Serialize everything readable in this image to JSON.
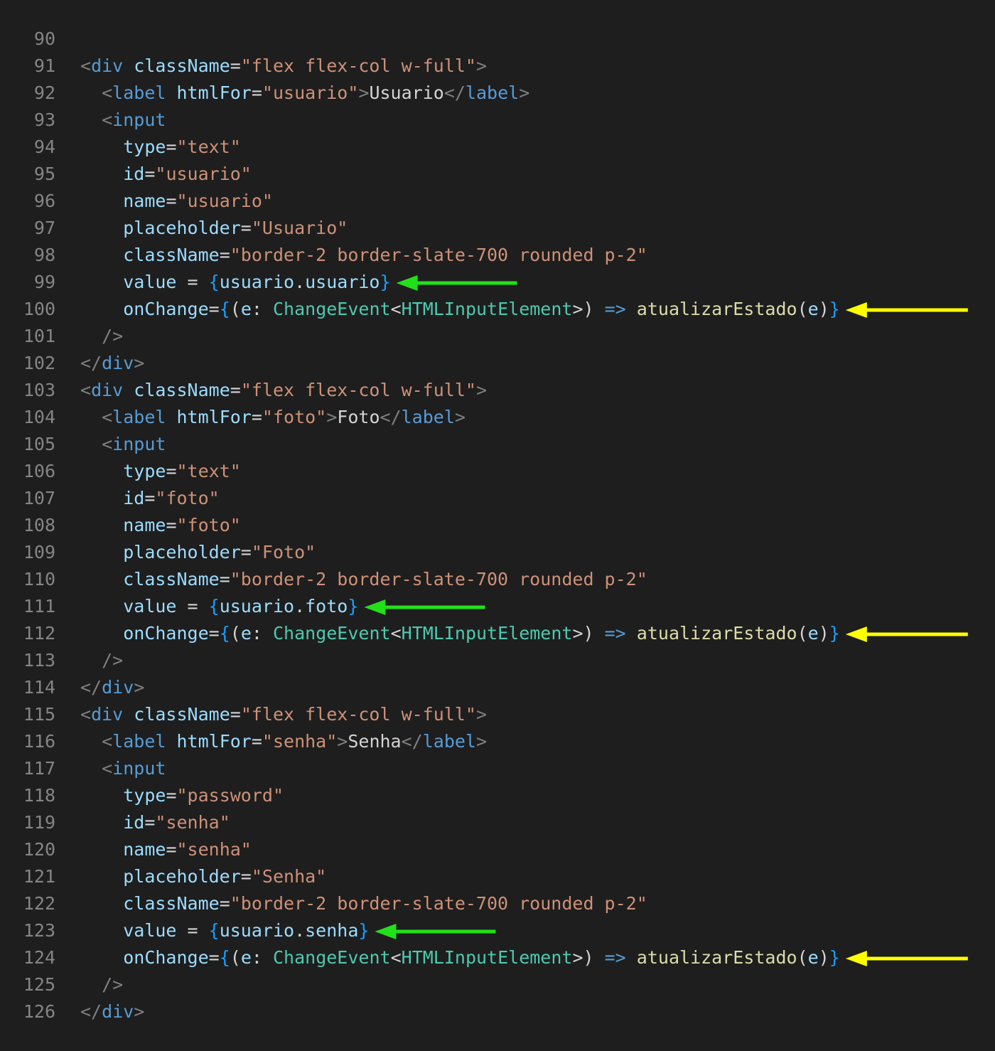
{
  "colors": {
    "background": "#1e1e1e",
    "line_number": "#858585",
    "tag": "#569cd6",
    "attribute": "#9cdcfe",
    "string": "#ce9178",
    "text": "#d4d4d4",
    "punctuation": "#808080",
    "brace": "#179fff",
    "type": "#4ec9b0",
    "function": "#dcdcaa",
    "value_arrow": "#22e01a",
    "onchange_arrow": "#ffff00"
  },
  "lines": [
    {
      "n": "90",
      "tokens": []
    },
    {
      "n": "91",
      "tokens": [
        [
          "punc",
          "<"
        ],
        [
          "tag",
          "div"
        ],
        [
          "txt",
          " "
        ],
        [
          "attr",
          "className"
        ],
        [
          "txt",
          "="
        ],
        [
          "str",
          "\"flex flex-col w-full\""
        ],
        [
          "punc",
          ">"
        ]
      ]
    },
    {
      "n": "92",
      "tokens": [
        [
          "txt",
          "  "
        ],
        [
          "punc",
          "<"
        ],
        [
          "tag",
          "label"
        ],
        [
          "txt",
          " "
        ],
        [
          "attr",
          "htmlFor"
        ],
        [
          "txt",
          "="
        ],
        [
          "str",
          "\"usuario\""
        ],
        [
          "punc",
          ">"
        ],
        [
          "txt",
          "Usuario"
        ],
        [
          "punc",
          "</"
        ],
        [
          "tag",
          "label"
        ],
        [
          "punc",
          ">"
        ]
      ]
    },
    {
      "n": "93",
      "tokens": [
        [
          "txt",
          "  "
        ],
        [
          "punc",
          "<"
        ],
        [
          "tag",
          "input"
        ]
      ]
    },
    {
      "n": "94",
      "tokens": [
        [
          "txt",
          "    "
        ],
        [
          "attr",
          "type"
        ],
        [
          "txt",
          "="
        ],
        [
          "str",
          "\"text\""
        ]
      ]
    },
    {
      "n": "95",
      "tokens": [
        [
          "txt",
          "    "
        ],
        [
          "attr",
          "id"
        ],
        [
          "txt",
          "="
        ],
        [
          "str",
          "\"usuario\""
        ]
      ]
    },
    {
      "n": "96",
      "tokens": [
        [
          "txt",
          "    "
        ],
        [
          "attr",
          "name"
        ],
        [
          "txt",
          "="
        ],
        [
          "str",
          "\"usuario\""
        ]
      ]
    },
    {
      "n": "97",
      "tokens": [
        [
          "txt",
          "    "
        ],
        [
          "attr",
          "placeholder"
        ],
        [
          "txt",
          "="
        ],
        [
          "str",
          "\"Usuario\""
        ]
      ]
    },
    {
      "n": "98",
      "tokens": [
        [
          "txt",
          "    "
        ],
        [
          "attr",
          "className"
        ],
        [
          "txt",
          "="
        ],
        [
          "str",
          "\"border-2 border-slate-700 rounded p-2\""
        ]
      ]
    },
    {
      "n": "99",
      "tokens": [
        [
          "txt",
          "    "
        ],
        [
          "attr",
          "value"
        ],
        [
          "txt",
          " = "
        ],
        [
          "brace",
          "{"
        ],
        [
          "attr",
          "usuario"
        ],
        [
          "txt",
          "."
        ],
        [
          "attr",
          "usuario"
        ],
        [
          "brace",
          "}"
        ]
      ]
    },
    {
      "n": "100",
      "tokens": [
        [
          "txt",
          "    "
        ],
        [
          "attr",
          "onChange"
        ],
        [
          "txt",
          "="
        ],
        [
          "brace",
          "{"
        ],
        [
          "txt",
          "("
        ],
        [
          "attr",
          "e"
        ],
        [
          "txt",
          ": "
        ],
        [
          "type",
          "ChangeEvent"
        ],
        [
          "txt",
          "<"
        ],
        [
          "type",
          "HTMLInputElement"
        ],
        [
          "txt",
          ">) "
        ],
        [
          "arrowop",
          "=>"
        ],
        [
          "txt",
          " "
        ],
        [
          "func",
          "atualizarEstado"
        ],
        [
          "txt",
          "("
        ],
        [
          "attr",
          "e"
        ],
        [
          "txt",
          ")"
        ],
        [
          "brace",
          "}"
        ]
      ]
    },
    {
      "n": "101",
      "tokens": [
        [
          "txt",
          "  "
        ],
        [
          "punc",
          "/>"
        ]
      ]
    },
    {
      "n": "102",
      "tokens": [
        [
          "punc",
          "</"
        ],
        [
          "tag",
          "div"
        ],
        [
          "punc",
          ">"
        ]
      ]
    },
    {
      "n": "103",
      "tokens": [
        [
          "punc",
          "<"
        ],
        [
          "tag",
          "div"
        ],
        [
          "txt",
          " "
        ],
        [
          "attr",
          "className"
        ],
        [
          "txt",
          "="
        ],
        [
          "str",
          "\"flex flex-col w-full\""
        ],
        [
          "punc",
          ">"
        ]
      ]
    },
    {
      "n": "104",
      "tokens": [
        [
          "txt",
          "  "
        ],
        [
          "punc",
          "<"
        ],
        [
          "tag",
          "label"
        ],
        [
          "txt",
          " "
        ],
        [
          "attr",
          "htmlFor"
        ],
        [
          "txt",
          "="
        ],
        [
          "str",
          "\"foto\""
        ],
        [
          "punc",
          ">"
        ],
        [
          "txt",
          "Foto"
        ],
        [
          "punc",
          "</"
        ],
        [
          "tag",
          "label"
        ],
        [
          "punc",
          ">"
        ]
      ]
    },
    {
      "n": "105",
      "tokens": [
        [
          "txt",
          "  "
        ],
        [
          "punc",
          "<"
        ],
        [
          "tag",
          "input"
        ]
      ]
    },
    {
      "n": "106",
      "tokens": [
        [
          "txt",
          "    "
        ],
        [
          "attr",
          "type"
        ],
        [
          "txt",
          "="
        ],
        [
          "str",
          "\"text\""
        ]
      ]
    },
    {
      "n": "107",
      "tokens": [
        [
          "txt",
          "    "
        ],
        [
          "attr",
          "id"
        ],
        [
          "txt",
          "="
        ],
        [
          "str",
          "\"foto\""
        ]
      ]
    },
    {
      "n": "108",
      "tokens": [
        [
          "txt",
          "    "
        ],
        [
          "attr",
          "name"
        ],
        [
          "txt",
          "="
        ],
        [
          "str",
          "\"foto\""
        ]
      ]
    },
    {
      "n": "109",
      "tokens": [
        [
          "txt",
          "    "
        ],
        [
          "attr",
          "placeholder"
        ],
        [
          "txt",
          "="
        ],
        [
          "str",
          "\"Foto\""
        ]
      ]
    },
    {
      "n": "110",
      "tokens": [
        [
          "txt",
          "    "
        ],
        [
          "attr",
          "className"
        ],
        [
          "txt",
          "="
        ],
        [
          "str",
          "\"border-2 border-slate-700 rounded p-2\""
        ]
      ]
    },
    {
      "n": "111",
      "tokens": [
        [
          "txt",
          "    "
        ],
        [
          "attr",
          "value"
        ],
        [
          "txt",
          " = "
        ],
        [
          "brace",
          "{"
        ],
        [
          "attr",
          "usuario"
        ],
        [
          "txt",
          "."
        ],
        [
          "attr",
          "foto"
        ],
        [
          "brace",
          "}"
        ]
      ]
    },
    {
      "n": "112",
      "tokens": [
        [
          "txt",
          "    "
        ],
        [
          "attr",
          "onChange"
        ],
        [
          "txt",
          "="
        ],
        [
          "brace",
          "{"
        ],
        [
          "txt",
          "("
        ],
        [
          "attr",
          "e"
        ],
        [
          "txt",
          ": "
        ],
        [
          "type",
          "ChangeEvent"
        ],
        [
          "txt",
          "<"
        ],
        [
          "type",
          "HTMLInputElement"
        ],
        [
          "txt",
          ">) "
        ],
        [
          "arrowop",
          "=>"
        ],
        [
          "txt",
          " "
        ],
        [
          "func",
          "atualizarEstado"
        ],
        [
          "txt",
          "("
        ],
        [
          "attr",
          "e"
        ],
        [
          "txt",
          ")"
        ],
        [
          "brace",
          "}"
        ]
      ]
    },
    {
      "n": "113",
      "tokens": [
        [
          "txt",
          "  "
        ],
        [
          "punc",
          "/>"
        ]
      ]
    },
    {
      "n": "114",
      "tokens": [
        [
          "punc",
          "</"
        ],
        [
          "tag",
          "div"
        ],
        [
          "punc",
          ">"
        ]
      ]
    },
    {
      "n": "115",
      "tokens": [
        [
          "punc",
          "<"
        ],
        [
          "tag",
          "div"
        ],
        [
          "txt",
          " "
        ],
        [
          "attr",
          "className"
        ],
        [
          "txt",
          "="
        ],
        [
          "str",
          "\"flex flex-col w-full\""
        ],
        [
          "punc",
          ">"
        ]
      ]
    },
    {
      "n": "116",
      "tokens": [
        [
          "txt",
          "  "
        ],
        [
          "punc",
          "<"
        ],
        [
          "tag",
          "label"
        ],
        [
          "txt",
          " "
        ],
        [
          "attr",
          "htmlFor"
        ],
        [
          "txt",
          "="
        ],
        [
          "str",
          "\"senha\""
        ],
        [
          "punc",
          ">"
        ],
        [
          "txt",
          "Senha"
        ],
        [
          "punc",
          "</"
        ],
        [
          "tag",
          "label"
        ],
        [
          "punc",
          ">"
        ]
      ]
    },
    {
      "n": "117",
      "tokens": [
        [
          "txt",
          "  "
        ],
        [
          "punc",
          "<"
        ],
        [
          "tag",
          "input"
        ]
      ]
    },
    {
      "n": "118",
      "tokens": [
        [
          "txt",
          "    "
        ],
        [
          "attr",
          "type"
        ],
        [
          "txt",
          "="
        ],
        [
          "str",
          "\"password\""
        ]
      ]
    },
    {
      "n": "119",
      "tokens": [
        [
          "txt",
          "    "
        ],
        [
          "attr",
          "id"
        ],
        [
          "txt",
          "="
        ],
        [
          "str",
          "\"senha\""
        ]
      ]
    },
    {
      "n": "120",
      "tokens": [
        [
          "txt",
          "    "
        ],
        [
          "attr",
          "name"
        ],
        [
          "txt",
          "="
        ],
        [
          "str",
          "\"senha\""
        ]
      ]
    },
    {
      "n": "121",
      "tokens": [
        [
          "txt",
          "    "
        ],
        [
          "attr",
          "placeholder"
        ],
        [
          "txt",
          "="
        ],
        [
          "str",
          "\"Senha\""
        ]
      ]
    },
    {
      "n": "122",
      "tokens": [
        [
          "txt",
          "    "
        ],
        [
          "attr",
          "className"
        ],
        [
          "txt",
          "="
        ],
        [
          "str",
          "\"border-2 border-slate-700 rounded p-2\""
        ]
      ]
    },
    {
      "n": "123",
      "tokens": [
        [
          "txt",
          "    "
        ],
        [
          "attr",
          "value"
        ],
        [
          "txt",
          " = "
        ],
        [
          "brace",
          "{"
        ],
        [
          "attr",
          "usuario"
        ],
        [
          "txt",
          "."
        ],
        [
          "attr",
          "senha"
        ],
        [
          "brace",
          "}"
        ]
      ]
    },
    {
      "n": "124",
      "tokens": [
        [
          "txt",
          "    "
        ],
        [
          "attr",
          "onChange"
        ],
        [
          "txt",
          "="
        ],
        [
          "brace",
          "{"
        ],
        [
          "txt",
          "("
        ],
        [
          "attr",
          "e"
        ],
        [
          "txt",
          ": "
        ],
        [
          "type",
          "ChangeEvent"
        ],
        [
          "txt",
          "<"
        ],
        [
          "type",
          "HTMLInputElement"
        ],
        [
          "txt",
          ">) "
        ],
        [
          "arrowop",
          "=>"
        ],
        [
          "txt",
          " "
        ],
        [
          "func",
          "atualizarEstado"
        ],
        [
          "txt",
          "("
        ],
        [
          "attr",
          "e"
        ],
        [
          "txt",
          ")"
        ],
        [
          "brace",
          "}"
        ]
      ]
    },
    {
      "n": "125",
      "tokens": [
        [
          "txt",
          "  "
        ],
        [
          "punc",
          "/>"
        ]
      ]
    },
    {
      "n": "126",
      "tokens": [
        [
          "punc",
          "</"
        ],
        [
          "tag",
          "div"
        ],
        [
          "punc",
          ">"
        ]
      ]
    }
  ],
  "annotations": [
    {
      "line": "99",
      "kind": "value",
      "icon": "green-arrow-icon"
    },
    {
      "line": "100",
      "kind": "onchange",
      "icon": "yellow-arrow-icon"
    },
    {
      "line": "111",
      "kind": "value",
      "icon": "green-arrow-icon"
    },
    {
      "line": "112",
      "kind": "onchange",
      "icon": "yellow-arrow-icon"
    },
    {
      "line": "123",
      "kind": "value",
      "icon": "green-arrow-icon"
    },
    {
      "line": "124",
      "kind": "onchange",
      "icon": "yellow-arrow-icon"
    }
  ]
}
